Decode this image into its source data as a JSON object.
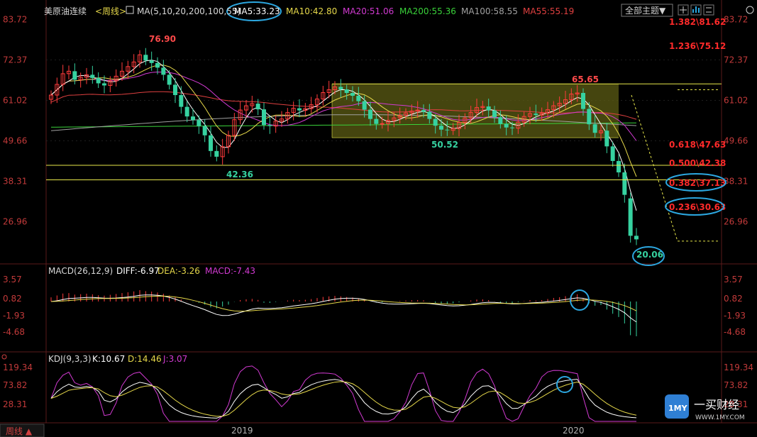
{
  "header": {
    "instrument": "美原油连续",
    "period": "<周线>",
    "ma_label": "MA(5,10,20,200,100,55)",
    "ma_values": [
      {
        "text": "MA5:33.23",
        "color": "#ffffff"
      },
      {
        "text": "MA10:42.80",
        "color": "#e6d84a"
      },
      {
        "text": "MA20:51.06",
        "color": "#d23ad2"
      },
      {
        "text": "MA200:55.36",
        "color": "#3ad23a"
      },
      {
        "text": "MA100:58.55",
        "color": "#a0a0a0"
      },
      {
        "text": "MA55:55.19",
        "color": "#e04040"
      }
    ],
    "theme_button": "全部主题▼"
  },
  "macd_header": {
    "name": "MACD(26,12,9)",
    "diff": "DIFF:-6.97",
    "dea": "DEA:-3.26",
    "macd": "MACD:-7.43"
  },
  "kdj_header": {
    "name": "KDJ(9,3,3)",
    "k": "K:10.67",
    "d": "D:14.46",
    "j": "J:3.07"
  },
  "footer": {
    "period_button": "周线 ▲",
    "x_labels": [
      "2019",
      "2020"
    ]
  },
  "watermark": {
    "logo_text": "1MY",
    "name": "一买财经",
    "url": "WWW.1MY.COM"
  },
  "colors": {
    "up": "#ff3b3b",
    "down": "#36d2a0",
    "axis": "#c23a3a",
    "box_fill": "#5c5c14",
    "box_line": "#e8e84a",
    "highlight": "#2ca7e0"
  },
  "chart_data": [
    {
      "type": "candlestick",
      "title": "美原油连续<周线>",
      "y_ticks": [
        "83.72",
        "72.37",
        "61.02",
        "49.66",
        "38.31",
        "26.96"
      ],
      "annotations": [
        "76.90",
        "65.65",
        "42.36",
        "50.52",
        "20.06"
      ],
      "fib_levels": [
        {
          "label": "1.382\\81.62",
          "value": 81.62
        },
        {
          "label": "1.236\\75.12",
          "value": 75.12
        },
        {
          "label": "0.618\\47.63",
          "value": 47.63
        },
        {
          "label": "0.500\\42.38",
          "value": 42.38
        },
        {
          "label": "0.382\\37.13",
          "value": 37.13
        },
        {
          "label": "0.236\\30.63",
          "value": 30.63
        }
      ],
      "horizontal_lines": [
        42.38,
        38.31
      ],
      "consolidation_box": {
        "high": 65.65,
        "low": 50.52
      },
      "ma_series": [
        {
          "name": "MA5",
          "color": "#ffffff"
        },
        {
          "name": "MA10",
          "color": "#e6d84a"
        },
        {
          "name": "MA20",
          "color": "#d23ad2"
        },
        {
          "name": "MA200",
          "color": "#3ad23a"
        },
        {
          "name": "MA100",
          "color": "#a0a0a0"
        },
        {
          "name": "MA55",
          "color": "#e04040"
        }
      ],
      "closes": [
        62.5,
        65.5,
        68.5,
        69.2,
        66.8,
        67.5,
        68.2,
        67.3,
        65.8,
        65.2,
        66.5,
        67.8,
        69.2,
        70.5,
        71.8,
        73.8,
        72.2,
        71.5,
        70.2,
        68.2,
        65.4,
        62.5,
        59.2,
        56.5,
        55.5,
        53.8,
        51.2,
        46.8,
        45.2,
        48.0,
        51.2,
        55.6,
        58.3,
        59.5,
        60.1,
        58.5,
        54.1,
        53.8,
        55.2,
        55.8,
        57.6,
        58.8,
        58.2,
        58.7,
        59.8,
        61.4,
        63.2,
        64.0,
        64.8,
        64.1,
        63.1,
        62.3,
        60.8,
        58.4,
        55.8,
        54.4,
        54.5,
        55.4,
        56.1,
        56.8,
        57.5,
        58.0,
        58.3,
        57.8,
        55.8,
        53.9,
        52.8,
        52.6,
        53.1,
        54.8,
        56.1,
        57.6,
        59.0,
        59.3,
        58.2,
        56.3,
        54.4,
        53.4,
        53.2,
        54.9,
        56.5,
        57.3,
        56.9,
        57.4,
        58.4,
        59.5,
        60.2,
        61.2,
        62.8,
        63.1,
        58.6,
        54.3,
        51.9,
        52.5,
        48.1,
        44.0,
        40.8,
        34.5,
        23.0,
        22.0
      ]
    },
    {
      "type": "line",
      "title": "MACD(26,12,9)",
      "y_ticks": [
        "3.57",
        "0.82",
        "-1.93",
        "-4.68"
      ],
      "series": [
        {
          "name": "DIFF",
          "last": -6.97
        },
        {
          "name": "DEA",
          "last": -3.26
        },
        {
          "name": "MACD",
          "last": -7.43
        }
      ]
    },
    {
      "type": "line",
      "title": "KDJ(9,3,3)",
      "y_ticks": [
        "119.34",
        "73.82",
        "28.31"
      ],
      "series": [
        {
          "name": "K",
          "last": 10.67
        },
        {
          "name": "D",
          "last": 14.46
        },
        {
          "name": "J",
          "last": 3.07
        }
      ]
    }
  ]
}
